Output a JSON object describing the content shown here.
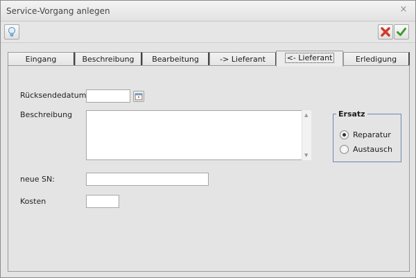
{
  "window": {
    "title": "Service-Vorgang anlegen",
    "close_glyph": "×"
  },
  "toolbar": {
    "info_icon": "lightbulb-icon",
    "cancel_icon": "red-x-icon",
    "ok_icon": "green-check-icon"
  },
  "tabs": [
    {
      "label": "Eingang",
      "active": false
    },
    {
      "label": "Beschreibung",
      "active": false
    },
    {
      "label": "Bearbeitung",
      "active": false
    },
    {
      "label": "-> Lieferant",
      "active": false
    },
    {
      "label": "<- Lieferant",
      "active": true
    },
    {
      "label": "Erledigung",
      "active": false
    }
  ],
  "form": {
    "ruecksendedatum_label": "Rücksendedatum",
    "ruecksendedatum_value": "",
    "beschreibung_label": "Beschreibung",
    "beschreibung_value": "",
    "neue_sn_label": "neue SN:",
    "neue_sn_value": "",
    "kosten_label": "Kosten",
    "kosten_value": ""
  },
  "ersatz": {
    "legend": "Ersatz",
    "options": [
      {
        "label": "Reparatur",
        "checked": true
      },
      {
        "label": "Austausch",
        "checked": false
      }
    ]
  },
  "colors": {
    "group_border": "#6b86b0",
    "cancel_red": "#d23a2a",
    "ok_green": "#3c9a2a"
  }
}
